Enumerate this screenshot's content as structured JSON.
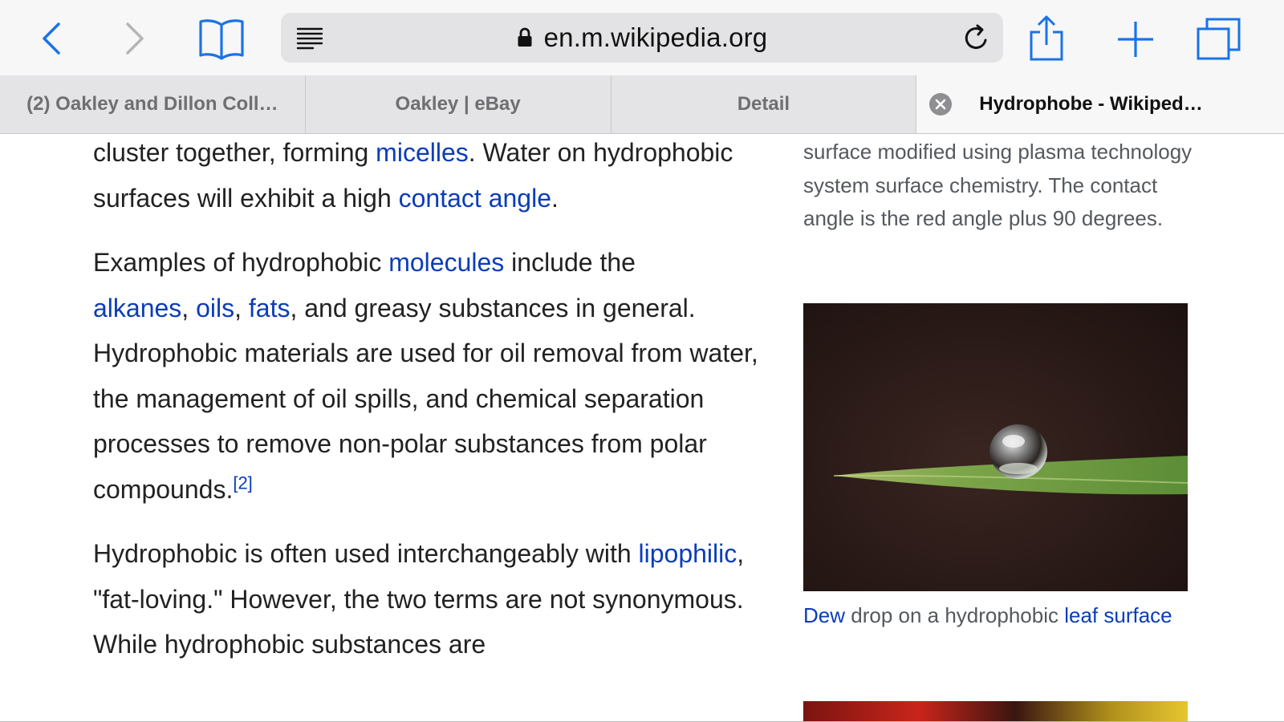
{
  "browser": {
    "icons": {
      "back": "chevron-left-icon",
      "forward": "chevron-right-icon",
      "bookmarks": "open-book-icon",
      "reader": "reader-lines-icon",
      "lock": "lock-icon",
      "reload": "reload-icon",
      "share": "share-icon",
      "new_tab": "plus-icon",
      "tabs": "tabs-icon"
    },
    "accent_color": "#1a73e8",
    "url": "en.m.wikipedia.org",
    "tabs": [
      {
        "label": "(2) Oakley and Dillon Coll…",
        "active": false
      },
      {
        "label": "Oakley | eBay",
        "active": false
      },
      {
        "label": "Detail",
        "active": false
      },
      {
        "label": "Hydrophobe - Wikiped…",
        "active": true
      }
    ]
  },
  "article": {
    "link_color": "#0b3db8",
    "p1": {
      "t1": "cluster together, forming ",
      "l1": "micelles",
      "t2": ". Water on hydrophobic surfaces will exhibit a high ",
      "l2": "contact angle",
      "t3": "."
    },
    "p2": {
      "t1": "Examples of hydrophobic ",
      "l1": "molecules",
      "t2": " include the ",
      "l2": "alkanes",
      "t3": ", ",
      "l3": "oils",
      "t4": ", ",
      "l4": "fats",
      "t5": ", and greasy substances in general. Hydrophobic materials are used for oil removal from water, the management of oil spills, and chemical separation processes to remove non-polar substances from polar compounds.",
      "ref": "[2]"
    },
    "p3": {
      "t1": "Hydrophobic is often used interchangeably with ",
      "l1": "lipophilic",
      "t2": ", \"fat-loving.\" However, the two terms are not synonymous. While hydrophobic substances are"
    }
  },
  "sidebar": {
    "top_caption": "surface modified using plasma technology system surface chemistry. The contact angle is the red angle plus 90 degrees.",
    "image_icon": "dew-drop-on-leaf-photo",
    "caption": {
      "l1": "Dew",
      "t1": " drop on a hydrophobic ",
      "l2": "leaf surface"
    }
  }
}
